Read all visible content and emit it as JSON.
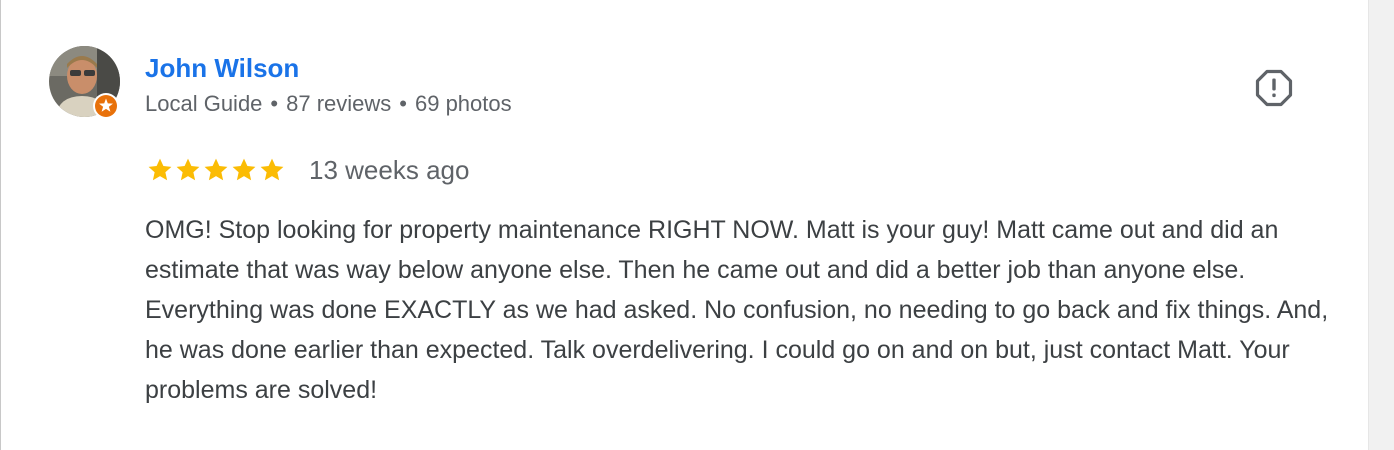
{
  "reviewer": {
    "name": "John Wilson",
    "badge": "Local Guide",
    "reviews": "87 reviews",
    "photos": "69 photos",
    "separator": "•"
  },
  "review": {
    "rating": 5,
    "max_rating": 5,
    "date": "13 weeks ago",
    "text": "OMG! Stop looking for property maintenance RIGHT NOW. Matt is your guy! Matt came out and did an estimate that was way below anyone else. Then he came out and did a better job than anyone else. Everything was done EXACTLY as we had asked. No confusion, no needing to go back and fix things. And, he was done earlier than expected. Talk overdelivering. I could go on and on but, just contact Matt. Your problems are solved!"
  },
  "icons": {
    "report": "report-flag-icon",
    "star": "star-icon",
    "badge": "local-guide-badge-icon"
  },
  "colors": {
    "name_link": "#1a73e8",
    "star": "#fbbc04",
    "badge": "#e8710a",
    "meta": "#5f6368",
    "body_text": "#3c4043"
  }
}
